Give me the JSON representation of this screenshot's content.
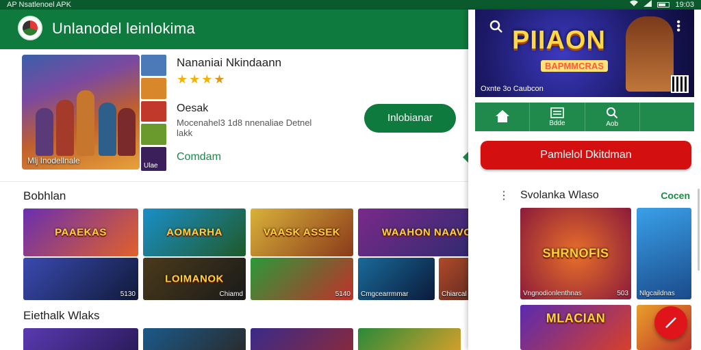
{
  "status_bar": {
    "left_text": "AP Nsatlenoel APK",
    "time": "19:03"
  },
  "app_bar": {
    "title": "Unlanodel leinlokima"
  },
  "featured": {
    "hero_caption": "Mlj Inodellnale",
    "thumb_label": "Ulae",
    "name": "Nananiai Nkindaann",
    "rating_stars": 4,
    "section_label": "Oesak",
    "description": "Mocenahel3 1d8 nnenaliae Detnel lakk",
    "commit_label": "Comdam",
    "install_label": "Inlobianar"
  },
  "section1": {
    "title": "Bobhlan",
    "tiles": [
      {
        "label": "PAAEKAS",
        "caption": "",
        "badge": ""
      },
      {
        "label": "AOMARHA",
        "caption": "",
        "badge": ""
      },
      {
        "label": "VAASK ASSEK",
        "caption": "",
        "badge": ""
      },
      {
        "label": "WAAHON NAAVODN",
        "caption": "",
        "badge": ""
      },
      {
        "label": "",
        "caption": "",
        "badge": "5130"
      },
      {
        "label": "LOIMANOK",
        "caption": "",
        "badge": "Chiamd"
      },
      {
        "label": "",
        "caption": "",
        "badge": "5140"
      },
      {
        "label": "",
        "caption": "Cmgcearrmmar",
        "badge": ""
      },
      {
        "label": "",
        "caption": "Chiarcal taimsal",
        "badge": ""
      }
    ]
  },
  "section2": {
    "title": "Eiethalk Wlaks"
  },
  "right_panel": {
    "banner_title": "PIIAON",
    "banner_subtitle": "BAPMMCRAS",
    "banner_caption": "Oxnte 3o Caubcon",
    "nav_items": [
      {
        "icon": "home-icon",
        "label": ""
      },
      {
        "icon": "list-icon",
        "label": "Bdde"
      },
      {
        "icon": "search-icon",
        "label": "Aob"
      },
      {
        "icon": "blank",
        "label": ""
      }
    ],
    "cta_label": "Pamlelol Dkitdman",
    "list_title": "Svolanka Wlaso",
    "list_more": "Cocen",
    "tiles": [
      {
        "label": "SHRNOFIS",
        "caption": "Vngnodionlenthnas",
        "badge": "503"
      },
      {
        "label": "",
        "caption": "Nlgcaildnas",
        "badge": ""
      },
      {
        "label": "MLACIAN",
        "caption": "",
        "badge": ""
      }
    ]
  },
  "colors": {
    "brand_green": "#0f7a3d",
    "status_green": "#0b5a2e",
    "accent_red": "#d40f0f",
    "star_yellow": "#f5b301"
  }
}
